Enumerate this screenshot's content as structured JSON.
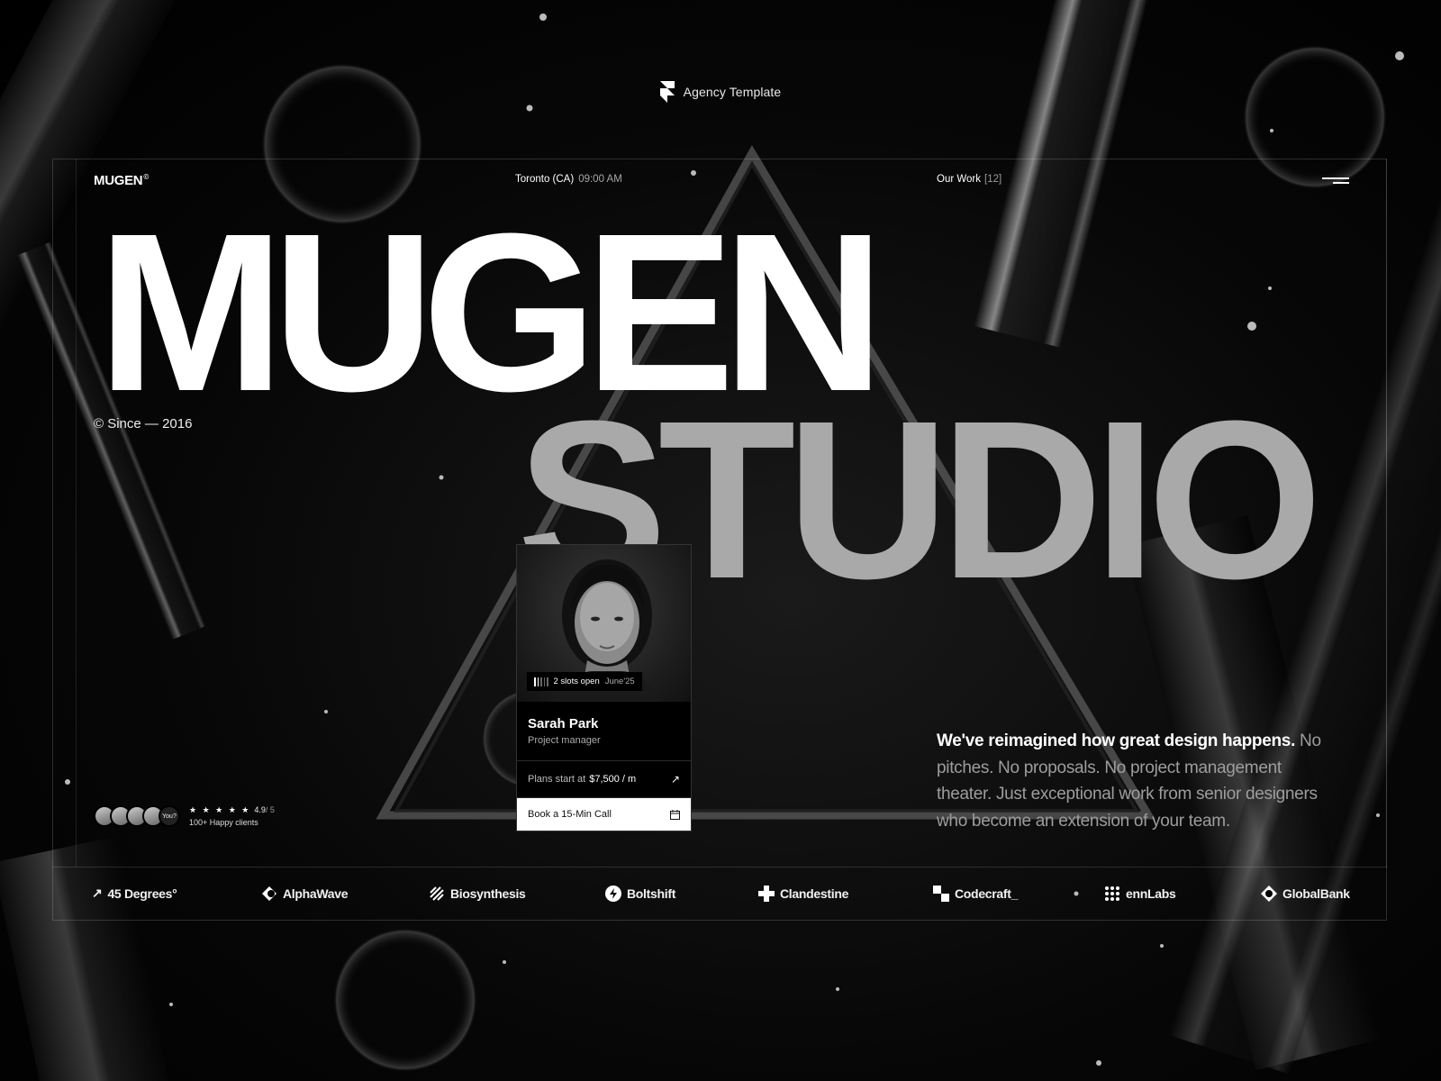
{
  "badge": {
    "text": "Agency Template"
  },
  "nav": {
    "brand": "MUGEN",
    "brand_mark": "©",
    "location": "Toronto (CA)",
    "time": "09:00 AM",
    "work_label": "Our Work",
    "work_count": "[12]"
  },
  "hero": {
    "line1": "MUGEN",
    "line2": "STUDIO",
    "since": "© Since — 2016"
  },
  "card": {
    "slots_text": "2 slots open",
    "slots_month": "June'25",
    "name": "Sarah Park",
    "role": "Project manager",
    "plans_label": "Plans start at",
    "plans_price": "$7,500 / m",
    "book_label": "Book a 15-Min Call"
  },
  "clients": {
    "you_label": "You?",
    "stars": "★ ★ ★ ★ ★",
    "score": "4.9",
    "score_of": "/ 5",
    "happy": "100+ Happy clients"
  },
  "description": {
    "highlight": "We've reimagined how great design happens.",
    "rest": " No pitches. No proposals. No project management theater. Just exceptional work from senior designers who become an extension of your team."
  },
  "logos": [
    "45 Degrees°",
    "AlphaWave",
    "Biosynthesis",
    "Boltshift",
    "Clandestine",
    "Codecraft_",
    "ennLabs",
    "GlobalBank"
  ],
  "colors": {
    "background": "#000000",
    "hero_primary": "#ffffff",
    "hero_secondary": "#a9a9a9",
    "muted_text": "#9d9d9d"
  }
}
